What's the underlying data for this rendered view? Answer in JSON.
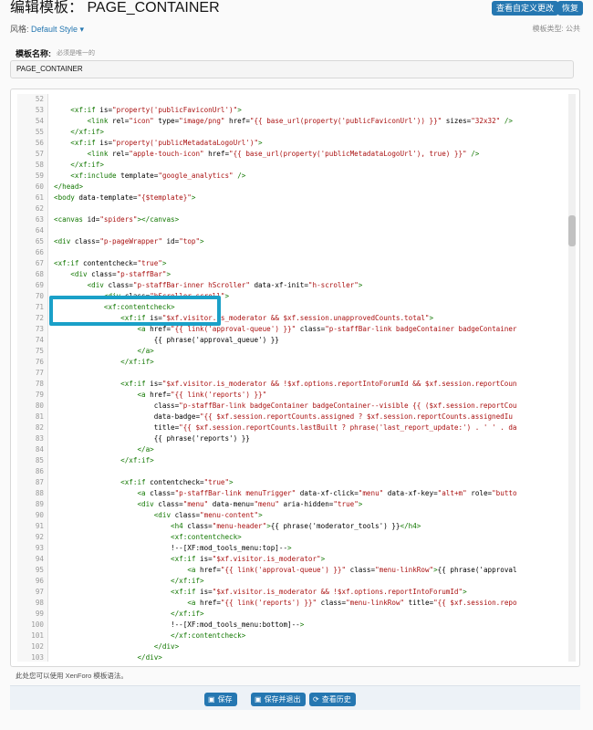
{
  "header": {
    "title": "编辑模板： PAGE_CONTAINER",
    "view_custom_changes": "查看自定义更改",
    "revert": "恢复"
  },
  "style_row": {
    "label": "风格:",
    "selected": "Default Style ▾"
  },
  "template_type": "模板类型:  公共",
  "template_name": {
    "label": "模板名称:",
    "hint": "必须是唯一的",
    "value": "PAGE_CONTAINER"
  },
  "editor": {
    "lines": [
      {
        "n": "52",
        "t": ""
      },
      {
        "n": "53",
        "t": "    <xf:if is=\"property('publicFaviconUrl')\">"
      },
      {
        "n": "54",
        "t": "        <link rel=\"icon\" type=\"image/png\" href=\"{{ base_url(property('publicFaviconUrl')) }}\" sizes=\"32x32\" />"
      },
      {
        "n": "55",
        "t": "    </xf:if>"
      },
      {
        "n": "56",
        "t": "    <xf:if is=\"property('publicMetadataLogoUrl')\">"
      },
      {
        "n": "57",
        "t": "        <link rel=\"apple-touch-icon\" href=\"{{ base_url(property('publicMetadataLogoUrl'), true) }}\" />"
      },
      {
        "n": "58",
        "t": "    </xf:if>"
      },
      {
        "n": "59",
        "t": "    <xf:include template=\"google_analytics\" />"
      },
      {
        "n": "60",
        "t": "</head>"
      },
      {
        "n": "61",
        "t": "<body data-template=\"{$template}\">"
      },
      {
        "n": "62",
        "t": ""
      },
      {
        "n": "63",
        "t": "<canvas id=\"spiders\"></canvas>"
      },
      {
        "n": "64",
        "t": ""
      },
      {
        "n": "65",
        "t": "<div class=\"p-pageWrapper\" id=\"top\">"
      },
      {
        "n": "66",
        "t": ""
      },
      {
        "n": "67",
        "t": "<xf:if contentcheck=\"true\">"
      },
      {
        "n": "68",
        "t": "    <div class=\"p-staffBar\">"
      },
      {
        "n": "69",
        "t": "        <div class=\"p-staffBar-inner hScroller\" data-xf-init=\"h-scroller\">"
      },
      {
        "n": "70",
        "t": "            <div class=\"hScroller-scroll\">"
      },
      {
        "n": "71",
        "t": "            <xf:contentcheck>"
      },
      {
        "n": "72",
        "t": "                <xf:if is=\"$xf.visitor.is_moderator && $xf.session.unapprovedCounts.total\">"
      },
      {
        "n": "73",
        "t": "                    <a href=\"{{ link('approval-queue') }}\" class=\"p-staffBar-link badgeContainer badgeContainer"
      },
      {
        "n": "74",
        "t": "                        {{ phrase('approval_queue') }}"
      },
      {
        "n": "75",
        "t": "                    </a>"
      },
      {
        "n": "76",
        "t": "                </xf:if>"
      },
      {
        "n": "77",
        "t": ""
      },
      {
        "n": "78",
        "t": "                <xf:if is=\"$xf.visitor.is_moderator && !$xf.options.reportIntoForumId && $xf.session.reportCoun"
      },
      {
        "n": "79",
        "t": "                    <a href=\"{{ link('reports') }}\""
      },
      {
        "n": "80",
        "t": "                        class=\"p-staffBar-link badgeContainer badgeContainer--visible {{ ($xf.session.reportCou"
      },
      {
        "n": "81",
        "t": "                        data-badge=\"{{ $xf.session.reportCounts.assigned ? $xf.session.reportCounts.assignedIu"
      },
      {
        "n": "82",
        "t": "                        title=\"{{ $xf.session.reportCounts.lastBuilt ? phrase('last_report_update:') . ' ' . da"
      },
      {
        "n": "83",
        "t": "                        {{ phrase('reports') }}"
      },
      {
        "n": "84",
        "t": "                    </a>"
      },
      {
        "n": "85",
        "t": "                </xf:if>"
      },
      {
        "n": "86",
        "t": ""
      },
      {
        "n": "87",
        "t": "                <xf:if contentcheck=\"true\">"
      },
      {
        "n": "88",
        "t": "                    <a class=\"p-staffBar-link menuTrigger\" data-xf-click=\"menu\" data-xf-key=\"alt+m\" role=\"butto"
      },
      {
        "n": "89",
        "t": "                    <div class=\"menu\" data-menu=\"menu\" aria-hidden=\"true\">"
      },
      {
        "n": "90",
        "t": "                        <div class=\"menu-content\">"
      },
      {
        "n": "91",
        "t": "                            <h4 class=\"menu-header\">{{ phrase('moderator_tools') }}</h4>"
      },
      {
        "n": "92",
        "t": "                            <xf:contentcheck>"
      },
      {
        "n": "93",
        "t": "                            <!--[XF:mod_tools_menu:top]-->"
      },
      {
        "n": "94",
        "t": "                            <xf:if is=\"$xf.visitor.is_moderator\">"
      },
      {
        "n": "95",
        "t": "                                <a href=\"{{ link('approval-queue') }}\" class=\"menu-linkRow\">{{ phrase('approval"
      },
      {
        "n": "96",
        "t": "                            </xf:if>"
      },
      {
        "n": "97",
        "t": "                            <xf:if is=\"$xf.visitor.is_moderator && !$xf.options.reportIntoForumId\">"
      },
      {
        "n": "98",
        "t": "                                <a href=\"{{ link('reports') }}\" class=\"menu-linkRow\" title=\"{{ $xf.session.repo"
      },
      {
        "n": "99",
        "t": "                            </xf:if>"
      },
      {
        "n": "100",
        "t": "                            <!--[XF:mod_tools_menu:bottom]-->"
      },
      {
        "n": "101",
        "t": "                            </xf:contentcheck>"
      },
      {
        "n": "102",
        "t": "                        </div>"
      },
      {
        "n": "103",
        "t": "                    </div>"
      }
    ]
  },
  "syntax_hint": "此处您可以使用 XenForo 模板语法。",
  "footer": {
    "save": "保存",
    "save_and_exit": "保存并退出",
    "view_history": "查看历史"
  },
  "colors": {
    "accent": "#2577b1",
    "highlight_box": "#1aa0c8",
    "tag": "#170",
    "attr_value": "#a11"
  }
}
